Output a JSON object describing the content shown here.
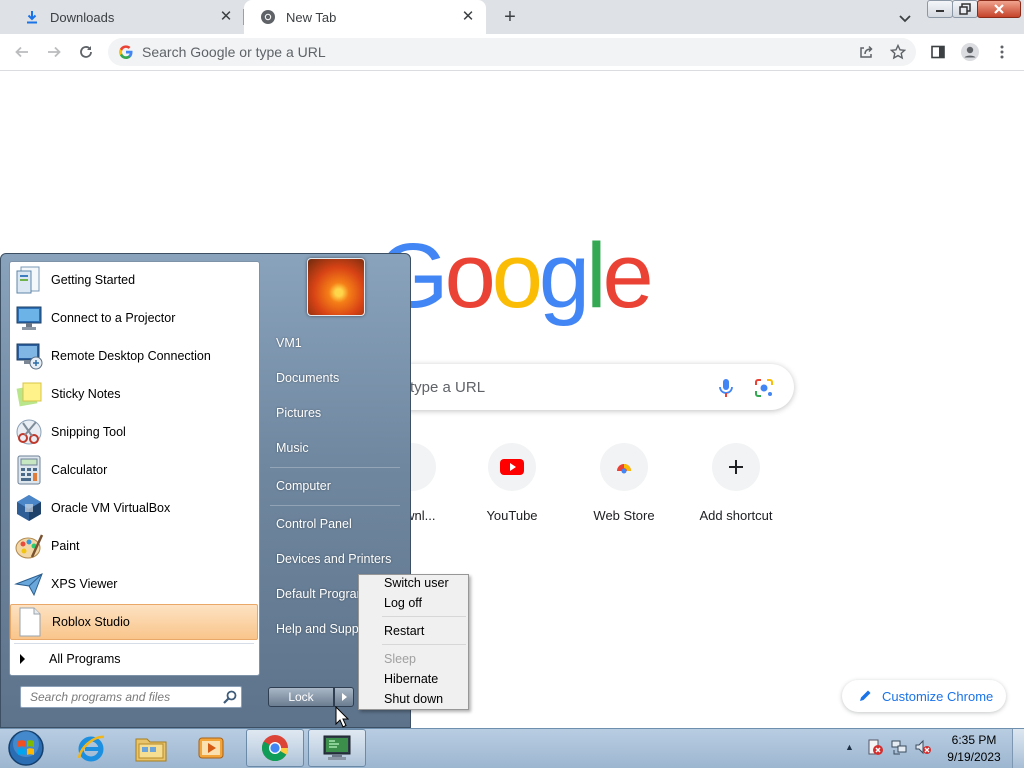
{
  "browser": {
    "tabs": [
      {
        "label": "Downloads",
        "icon": "download-icon"
      },
      {
        "label": "New Tab",
        "icon": "chrome-icon"
      }
    ],
    "omnibox_placeholder": "Search Google or type a URL"
  },
  "ntp": {
    "logo": [
      "G",
      "o",
      "o",
      "g",
      "l",
      "e"
    ],
    "logo_colors": [
      "#4285f4",
      "#ea4335",
      "#fbbc05",
      "#4285f4",
      "#34a853",
      "#ea4335"
    ],
    "search_placeholder": "type a URL",
    "shortcuts": [
      {
        "label": "Downl...",
        "icon": "download-icon"
      },
      {
        "label": "YouTube",
        "icon": "youtube-icon"
      },
      {
        "label": "Web Store",
        "icon": "webstore-icon"
      },
      {
        "label": "Add shortcut",
        "icon": "plus-icon"
      }
    ],
    "customize_label": "Customize Chrome"
  },
  "start_menu": {
    "programs": [
      {
        "label": "Getting Started",
        "icon": "getting-started-icon"
      },
      {
        "label": "Connect to a Projector",
        "icon": "projector-icon"
      },
      {
        "label": "Remote Desktop Connection",
        "icon": "remote-desktop-icon"
      },
      {
        "label": "Sticky Notes",
        "icon": "sticky-notes-icon"
      },
      {
        "label": "Snipping Tool",
        "icon": "snipping-tool-icon"
      },
      {
        "label": "Calculator",
        "icon": "calculator-icon"
      },
      {
        "label": "Oracle VM VirtualBox",
        "icon": "virtualbox-icon"
      },
      {
        "label": "Paint",
        "icon": "paint-icon"
      },
      {
        "label": "XPS Viewer",
        "icon": "xps-viewer-icon"
      },
      {
        "label": "Roblox Studio",
        "icon": "blank-document-icon",
        "highlighted": true
      }
    ],
    "all_programs": "All Programs",
    "search_placeholder": "Search programs and files",
    "right_items": [
      "VM1",
      "Documents",
      "Pictures",
      "Music",
      "Computer",
      "Control Panel",
      "Devices and Printers",
      "Default Programs",
      "Help and Support"
    ],
    "lock_label": "Lock",
    "power_menu": [
      {
        "label": "Switch user",
        "enabled": true
      },
      {
        "label": "Log off",
        "enabled": true
      },
      {
        "label": "Restart",
        "enabled": true
      },
      {
        "label": "Sleep",
        "enabled": false
      },
      {
        "label": "Hibernate",
        "enabled": true
      },
      {
        "label": "Shut down",
        "enabled": true
      }
    ]
  },
  "taskbar": {
    "pinned": [
      "start-orb-icon",
      "internet-explorer-icon",
      "file-explorer-icon",
      "media-player-icon",
      "chrome-icon",
      "virtualbox-manager-icon"
    ],
    "tray": [
      "action-center-icon",
      "network-icon",
      "volume-muted-icon"
    ],
    "time": "6:35 PM",
    "date": "9/19/2023"
  }
}
